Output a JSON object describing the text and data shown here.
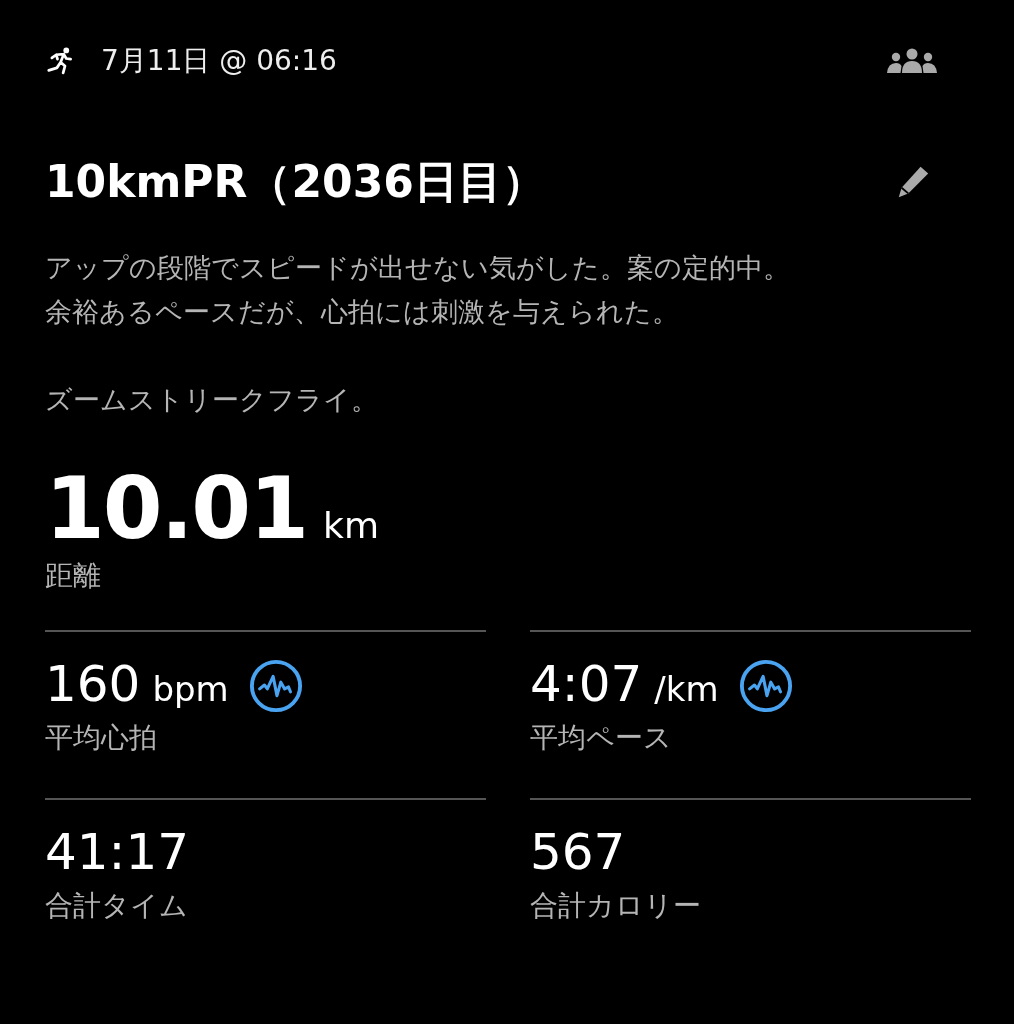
{
  "header": {
    "date": "7月11日 @ 06:16"
  },
  "title": "10kmPR（2036日目）",
  "description": [
    "アップの段階でスピードが出せない気がした。案の定的中。",
    "余裕あるペースだが、心拍には刺激を与えられた。"
  ],
  "note": "ズームストリークフライ。",
  "distance": {
    "value": "10.01",
    "unit": "km",
    "label": "距離"
  },
  "stats": [
    {
      "value": "160",
      "unit": "bpm",
      "label": "平均心拍",
      "graph_icon": true
    },
    {
      "value": "4:07",
      "unit": "/km",
      "label": "平均ペース",
      "graph_icon": true
    },
    {
      "value": "41:17",
      "label": "合計タイム",
      "graph_icon": false
    },
    {
      "value": "567",
      "label": "合計カロリー",
      "graph_icon": false
    }
  ]
}
